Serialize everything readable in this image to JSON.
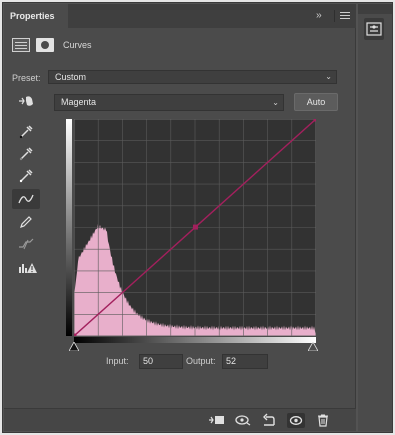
{
  "panel": {
    "tab_title": "Properties",
    "tab_close": "×",
    "collapse_glyph": "››",
    "menu_icon": "menu-icon"
  },
  "header": {
    "adjustment_icon": "curves-adjustment-icon",
    "mask_icon": "layer-mask-icon",
    "title": "Curves"
  },
  "preset": {
    "label": "Preset:",
    "value": "Custom"
  },
  "channel": {
    "value": "Magenta",
    "auto_label": "Auto"
  },
  "tools": [
    {
      "name": "on-image-adjust-icon"
    },
    {
      "name": "black-point-eyedropper-icon"
    },
    {
      "name": "gray-point-eyedropper-icon"
    },
    {
      "name": "white-point-eyedropper-icon"
    },
    {
      "name": "edit-points-curve-icon",
      "active": true
    },
    {
      "name": "pencil-draw-icon"
    },
    {
      "name": "smooth-curve-icon"
    },
    {
      "name": "clipping-warning-icon"
    }
  ],
  "curve": {
    "color": "#a3205d",
    "histogram_color": "#f2b6d4",
    "points": [
      [
        0,
        0
      ],
      [
        128,
        128
      ],
      [
        255,
        255
      ]
    ]
  },
  "input": {
    "label": "Input:",
    "value": "50"
  },
  "output": {
    "label": "Output:",
    "value": "52"
  },
  "bottom_bar": [
    {
      "name": "clip-to-layer-icon"
    },
    {
      "name": "view-previous-state-icon"
    },
    {
      "name": "reset-icon"
    },
    {
      "name": "visibility-eye-icon",
      "active": true
    },
    {
      "name": "trash-icon"
    }
  ],
  "dock": {
    "button_icon": "properties-panel-icon"
  }
}
